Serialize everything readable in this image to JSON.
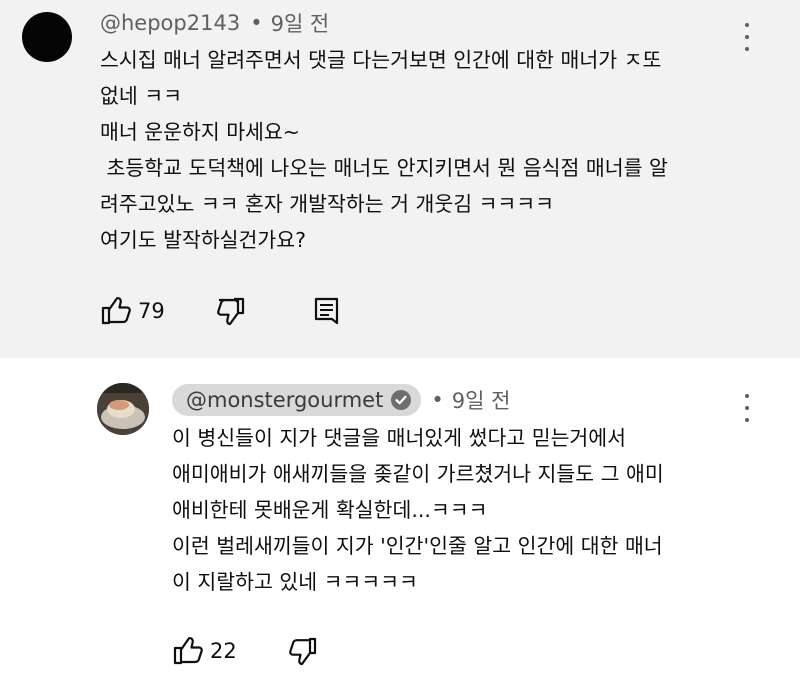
{
  "comments": [
    {
      "handle": "@hepop2143",
      "separator": "•",
      "time": "9일 전",
      "lines": [
        "스시집 매너 알려주면서 댓글 다는거보면 인간에 대한 매너가 ㅈ또",
        "없네 ㅋㅋ",
        "매너 운운하지 마세요~",
        " 초등학교 도덕책에 나오는 매너도 안지키면서 뭔 음식점 매너를 알",
        "려주고있노 ㅋㅋ 혼자 개발작하는 거 개웃김 ㅋㅋㅋㅋ",
        "여기도 발작하실건가요?"
      ],
      "likes": "79"
    },
    {
      "handle": "@monstergourmet",
      "separator": "•",
      "time": "9일 전",
      "lines": [
        "이 병신들이 지가 댓글을 매너있게 썼다고 믿는거에서",
        "애미애비가 애새끼들을 좆같이 가르쳤거나 지들도 그 애미",
        "애비한테 못배운게 확실한데...ㅋㅋㅋ",
        "이런 벌레새끼들이 지가 '인간'인줄 알고 인간에 대한 매너",
        "이 지랄하고 있네 ㅋㅋㅋㅋㅋ"
      ],
      "likes": "22"
    }
  ],
  "icons": {
    "like": "thumbs-up-icon",
    "dislike": "thumbs-down-icon",
    "reply": "reply-icon",
    "more": "more-vertical-icon",
    "verified": "verified-check-icon"
  },
  "colors": {
    "highlight_bg": "#f2f2f2",
    "owner_pill": "#d9d9d9",
    "meta_text": "#606060"
  }
}
